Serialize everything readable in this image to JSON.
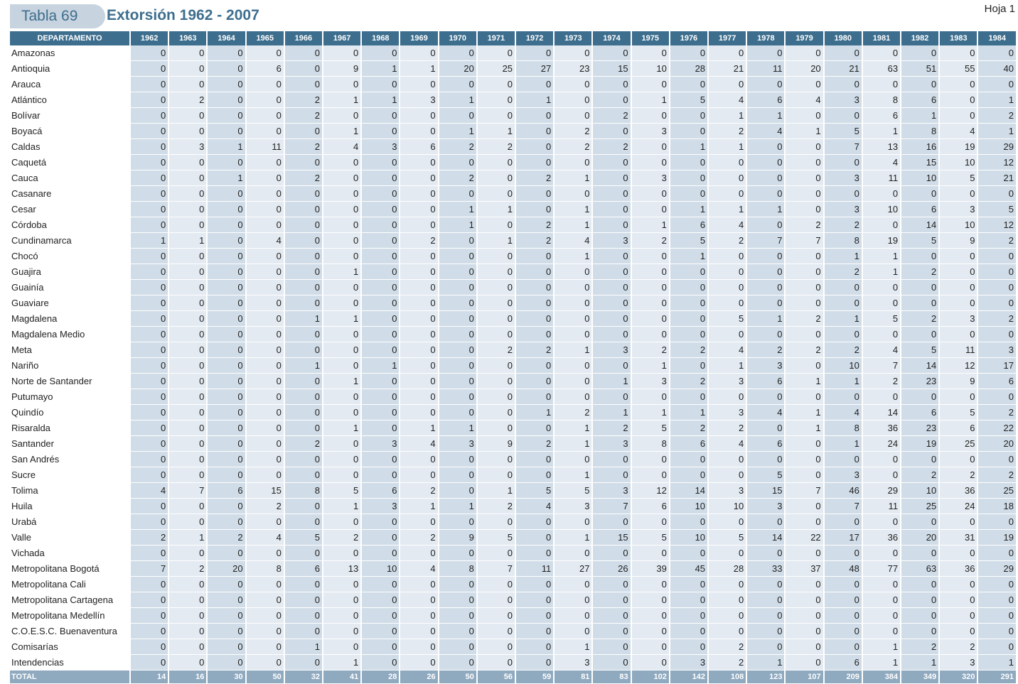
{
  "header": {
    "tab_label": "Tabla 69",
    "title": "Extorsión 1962 - 2007",
    "sheet": "Hoja 1"
  },
  "table": {
    "dept_header": "DEPARTAMENTO",
    "years": [
      "1962",
      "1963",
      "1964",
      "1965",
      "1966",
      "1967",
      "1968",
      "1969",
      "1970",
      "1971",
      "1972",
      "1973",
      "1974",
      "1975",
      "1976",
      "1977",
      "1978",
      "1979",
      "1980",
      "1981",
      "1982",
      "1983",
      "1984"
    ],
    "rows": [
      {
        "name": "Amazonas",
        "values": [
          0,
          0,
          0,
          0,
          0,
          0,
          0,
          0,
          0,
          0,
          0,
          0,
          0,
          0,
          0,
          0,
          0,
          0,
          0,
          0,
          0,
          0,
          0
        ]
      },
      {
        "name": "Antioquia",
        "values": [
          0,
          0,
          0,
          6,
          0,
          9,
          1,
          1,
          20,
          25,
          27,
          23,
          15,
          10,
          28,
          21,
          11,
          20,
          21,
          63,
          51,
          55,
          40
        ]
      },
      {
        "name": "Arauca",
        "values": [
          0,
          0,
          0,
          0,
          0,
          0,
          0,
          0,
          0,
          0,
          0,
          0,
          0,
          0,
          0,
          0,
          0,
          0,
          0,
          0,
          0,
          0,
          0
        ]
      },
      {
        "name": "Atlántico",
        "values": [
          0,
          2,
          0,
          0,
          2,
          1,
          1,
          3,
          1,
          0,
          1,
          0,
          0,
          1,
          5,
          4,
          6,
          4,
          3,
          8,
          6,
          0,
          1
        ]
      },
      {
        "name": "Bolívar",
        "values": [
          0,
          0,
          0,
          0,
          2,
          0,
          0,
          0,
          0,
          0,
          0,
          0,
          2,
          0,
          0,
          1,
          1,
          0,
          0,
          6,
          1,
          0,
          2
        ]
      },
      {
        "name": "Boyacá",
        "values": [
          0,
          0,
          0,
          0,
          0,
          1,
          0,
          0,
          1,
          1,
          0,
          2,
          0,
          3,
          0,
          2,
          4,
          1,
          5,
          1,
          8,
          4,
          1
        ]
      },
      {
        "name": "Caldas",
        "values": [
          0,
          3,
          1,
          11,
          2,
          4,
          3,
          6,
          2,
          2,
          0,
          2,
          2,
          0,
          1,
          1,
          0,
          0,
          7,
          13,
          16,
          19,
          29
        ]
      },
      {
        "name": "Caquetá",
        "values": [
          0,
          0,
          0,
          0,
          0,
          0,
          0,
          0,
          0,
          0,
          0,
          0,
          0,
          0,
          0,
          0,
          0,
          0,
          0,
          4,
          15,
          10,
          12
        ]
      },
      {
        "name": "Cauca",
        "values": [
          0,
          0,
          1,
          0,
          2,
          0,
          0,
          0,
          2,
          0,
          2,
          1,
          0,
          3,
          0,
          0,
          0,
          0,
          3,
          11,
          10,
          5,
          21
        ]
      },
      {
        "name": "Casanare",
        "values": [
          0,
          0,
          0,
          0,
          0,
          0,
          0,
          0,
          0,
          0,
          0,
          0,
          0,
          0,
          0,
          0,
          0,
          0,
          0,
          0,
          0,
          0,
          0
        ]
      },
      {
        "name": "Cesar",
        "values": [
          0,
          0,
          0,
          0,
          0,
          0,
          0,
          0,
          1,
          1,
          0,
          1,
          0,
          0,
          1,
          1,
          1,
          0,
          3,
          10,
          6,
          3,
          5
        ]
      },
      {
        "name": "Córdoba",
        "values": [
          0,
          0,
          0,
          0,
          0,
          0,
          0,
          0,
          1,
          0,
          2,
          1,
          0,
          1,
          6,
          4,
          0,
          2,
          2,
          0,
          14,
          10,
          12
        ]
      },
      {
        "name": "Cundinamarca",
        "values": [
          1,
          1,
          0,
          4,
          0,
          0,
          0,
          2,
          0,
          1,
          2,
          4,
          3,
          2,
          5,
          2,
          7,
          7,
          8,
          19,
          5,
          9,
          2
        ]
      },
      {
        "name": "Chocó",
        "values": [
          0,
          0,
          0,
          0,
          0,
          0,
          0,
          0,
          0,
          0,
          0,
          1,
          0,
          0,
          1,
          0,
          0,
          0,
          1,
          1,
          0,
          0,
          0
        ]
      },
      {
        "name": "Guajira",
        "values": [
          0,
          0,
          0,
          0,
          0,
          1,
          0,
          0,
          0,
          0,
          0,
          0,
          0,
          0,
          0,
          0,
          0,
          0,
          2,
          1,
          2,
          0,
          0
        ]
      },
      {
        "name": "Guainía",
        "values": [
          0,
          0,
          0,
          0,
          0,
          0,
          0,
          0,
          0,
          0,
          0,
          0,
          0,
          0,
          0,
          0,
          0,
          0,
          0,
          0,
          0,
          0,
          0
        ]
      },
      {
        "name": "Guaviare",
        "values": [
          0,
          0,
          0,
          0,
          0,
          0,
          0,
          0,
          0,
          0,
          0,
          0,
          0,
          0,
          0,
          0,
          0,
          0,
          0,
          0,
          0,
          0,
          0
        ]
      },
      {
        "name": "Magdalena",
        "values": [
          0,
          0,
          0,
          0,
          1,
          1,
          0,
          0,
          0,
          0,
          0,
          0,
          0,
          0,
          0,
          5,
          1,
          2,
          1,
          5,
          2,
          3,
          2
        ]
      },
      {
        "name": "Magdalena Medio",
        "values": [
          0,
          0,
          0,
          0,
          0,
          0,
          0,
          0,
          0,
          0,
          0,
          0,
          0,
          0,
          0,
          0,
          0,
          0,
          0,
          0,
          0,
          0,
          0
        ]
      },
      {
        "name": "Meta",
        "values": [
          0,
          0,
          0,
          0,
          0,
          0,
          0,
          0,
          0,
          2,
          2,
          1,
          3,
          2,
          2,
          4,
          2,
          2,
          2,
          4,
          5,
          11,
          3
        ]
      },
      {
        "name": "Nariño",
        "values": [
          0,
          0,
          0,
          0,
          1,
          0,
          1,
          0,
          0,
          0,
          0,
          0,
          0,
          1,
          0,
          1,
          3,
          0,
          10,
          7,
          14,
          12,
          17
        ]
      },
      {
        "name": "Norte de Santander",
        "values": [
          0,
          0,
          0,
          0,
          0,
          1,
          0,
          0,
          0,
          0,
          0,
          0,
          1,
          3,
          2,
          3,
          6,
          1,
          1,
          2,
          23,
          9,
          6
        ]
      },
      {
        "name": "Putumayo",
        "values": [
          0,
          0,
          0,
          0,
          0,
          0,
          0,
          0,
          0,
          0,
          0,
          0,
          0,
          0,
          0,
          0,
          0,
          0,
          0,
          0,
          0,
          0,
          0
        ]
      },
      {
        "name": "Quindío",
        "values": [
          0,
          0,
          0,
          0,
          0,
          0,
          0,
          0,
          0,
          0,
          1,
          2,
          1,
          1,
          1,
          3,
          4,
          1,
          4,
          14,
          6,
          5,
          2
        ]
      },
      {
        "name": "Risaralda",
        "values": [
          0,
          0,
          0,
          0,
          0,
          1,
          0,
          1,
          1,
          0,
          0,
          1,
          2,
          5,
          2,
          2,
          0,
          1,
          8,
          36,
          23,
          6,
          22
        ]
      },
      {
        "name": "Santander",
        "values": [
          0,
          0,
          0,
          0,
          2,
          0,
          3,
          4,
          3,
          9,
          2,
          1,
          3,
          8,
          6,
          4,
          6,
          0,
          1,
          24,
          19,
          25,
          20
        ]
      },
      {
        "name": "San Andrés",
        "values": [
          0,
          0,
          0,
          0,
          0,
          0,
          0,
          0,
          0,
          0,
          0,
          0,
          0,
          0,
          0,
          0,
          0,
          0,
          0,
          0,
          0,
          0,
          0
        ]
      },
      {
        "name": "Sucre",
        "values": [
          0,
          0,
          0,
          0,
          0,
          0,
          0,
          0,
          0,
          0,
          0,
          1,
          0,
          0,
          0,
          0,
          5,
          0,
          3,
          0,
          2,
          2,
          2
        ]
      },
      {
        "name": "Tolima",
        "values": [
          4,
          7,
          6,
          15,
          8,
          5,
          6,
          2,
          0,
          1,
          5,
          5,
          3,
          12,
          14,
          3,
          15,
          7,
          46,
          29,
          10,
          36,
          25
        ]
      },
      {
        "name": "Huila",
        "values": [
          0,
          0,
          0,
          2,
          0,
          1,
          3,
          1,
          1,
          2,
          4,
          3,
          7,
          6,
          10,
          10,
          3,
          0,
          7,
          11,
          25,
          24,
          18
        ]
      },
      {
        "name": "Urabá",
        "values": [
          0,
          0,
          0,
          0,
          0,
          0,
          0,
          0,
          0,
          0,
          0,
          0,
          0,
          0,
          0,
          0,
          0,
          0,
          0,
          0,
          0,
          0,
          0
        ]
      },
      {
        "name": "Valle",
        "values": [
          2,
          1,
          2,
          4,
          5,
          2,
          0,
          2,
          9,
          5,
          0,
          1,
          15,
          5,
          10,
          5,
          14,
          22,
          17,
          36,
          20,
          31,
          19
        ]
      },
      {
        "name": "Vichada",
        "values": [
          0,
          0,
          0,
          0,
          0,
          0,
          0,
          0,
          0,
          0,
          0,
          0,
          0,
          0,
          0,
          0,
          0,
          0,
          0,
          0,
          0,
          0,
          0
        ]
      },
      {
        "name": "Metropolitana Bogotá",
        "values": [
          7,
          2,
          20,
          8,
          6,
          13,
          10,
          4,
          8,
          7,
          11,
          27,
          26,
          39,
          45,
          28,
          33,
          37,
          48,
          77,
          63,
          36,
          29
        ]
      },
      {
        "name": "Metropolitana Cali",
        "values": [
          0,
          0,
          0,
          0,
          0,
          0,
          0,
          0,
          0,
          0,
          0,
          0,
          0,
          0,
          0,
          0,
          0,
          0,
          0,
          0,
          0,
          0,
          0
        ]
      },
      {
        "name": "Metropolitana Cartagena",
        "values": [
          0,
          0,
          0,
          0,
          0,
          0,
          0,
          0,
          0,
          0,
          0,
          0,
          0,
          0,
          0,
          0,
          0,
          0,
          0,
          0,
          0,
          0,
          0
        ]
      },
      {
        "name": "Metropolitana Medellín",
        "values": [
          0,
          0,
          0,
          0,
          0,
          0,
          0,
          0,
          0,
          0,
          0,
          0,
          0,
          0,
          0,
          0,
          0,
          0,
          0,
          0,
          0,
          0,
          0
        ]
      },
      {
        "name": "C.O.E.S.C. Buenaventura",
        "values": [
          0,
          0,
          0,
          0,
          0,
          0,
          0,
          0,
          0,
          0,
          0,
          0,
          0,
          0,
          0,
          0,
          0,
          0,
          0,
          0,
          0,
          0,
          0
        ]
      },
      {
        "name": "Comisarías",
        "values": [
          0,
          0,
          0,
          0,
          1,
          0,
          0,
          0,
          0,
          0,
          0,
          1,
          0,
          0,
          0,
          2,
          0,
          0,
          0,
          1,
          2,
          2,
          0
        ]
      },
      {
        "name": "Intendencias",
        "values": [
          0,
          0,
          0,
          0,
          0,
          1,
          0,
          0,
          0,
          0,
          0,
          3,
          0,
          0,
          3,
          2,
          1,
          0,
          6,
          1,
          1,
          3,
          1
        ]
      }
    ],
    "total": {
      "name": "TOTAL",
      "values": [
        14,
        16,
        30,
        50,
        32,
        41,
        28,
        26,
        50,
        56,
        59,
        81,
        83,
        102,
        142,
        108,
        123,
        107,
        209,
        384,
        349,
        320,
        291
      ]
    }
  }
}
